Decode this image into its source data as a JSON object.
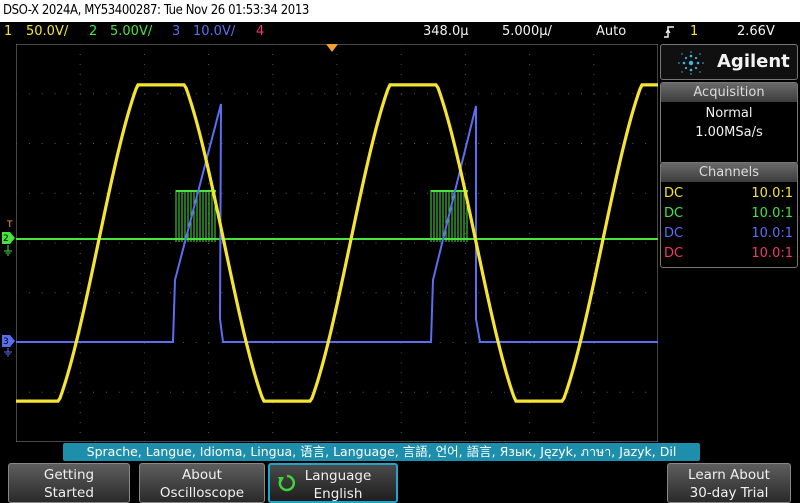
{
  "title": "DSO-X 2024A, MY53400287: Tue Nov 26 01:53:34 2013",
  "status": {
    "ch1": {
      "num": "1",
      "scale": "50.0V/"
    },
    "ch2": {
      "num": "2",
      "scale": "5.00V/"
    },
    "ch3": {
      "num": "3",
      "scale": "10.0V/"
    },
    "ch4": {
      "num": "4"
    },
    "delay": "348.0µ",
    "timebase": "5.000µ/",
    "trigger_mode": "Auto",
    "trigger_icon": "rising-edge-icon",
    "trigger_source": "1",
    "trigger_level": "2.66V"
  },
  "brand": "Agilent",
  "acquisition": {
    "header": "Acquisition",
    "mode": "Normal",
    "rate": "1.00MSa/s"
  },
  "channels": {
    "header": "Channels",
    "rows": [
      {
        "coupling": "DC",
        "ratio": "10.0:1",
        "color": "#f5e532"
      },
      {
        "coupling": "DC",
        "ratio": "10.0:1",
        "color": "#47e33f"
      },
      {
        "coupling": "DC",
        "ratio": "10.0:1",
        "color": "#5b6ef2"
      },
      {
        "coupling": "DC",
        "ratio": "10.0:1",
        "color": "#f0376f"
      }
    ]
  },
  "markers": {
    "trigger": "T",
    "ch2": "2",
    "ch3": "3"
  },
  "language_bar": "Sprache, Langue, Idioma, Lingua, 语言, Language, 言語, 언어, 語言, Язык, Język, ภาษา, Jazyk, Dil",
  "softkeys": [
    {
      "line1": "Getting",
      "line2": "Started"
    },
    {
      "line1": "About",
      "line2": "Oscilloscope"
    },
    {
      "line1": "Language",
      "line2": "English",
      "icon": "rotary-knob-icon"
    },
    {
      "line1": "Learn About",
      "line2": "30-day Trial"
    }
  ],
  "colors": {
    "ch1": "#f5e532",
    "ch2": "#47e33f",
    "ch3": "#5b6ef2",
    "ch4": "#f0376f",
    "accent": "#1d8fad"
  }
}
